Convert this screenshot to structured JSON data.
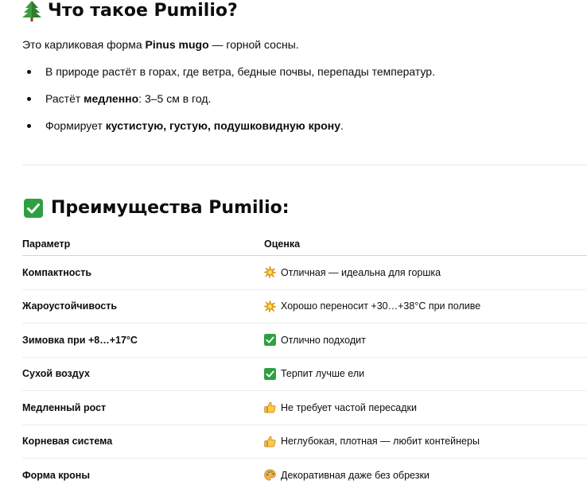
{
  "section1": {
    "title": "Что такое Pumilio?",
    "icon": "evergreen-tree-icon",
    "intro": {
      "prefix": "Это карликовая форма ",
      "bold": "Pinus mugo",
      "suffix": " — горной сосны."
    },
    "bullets": [
      {
        "prefix": "В природе растёт в горах, где ветра, бедные почвы, перепады температур.",
        "bold": "",
        "suffix": ""
      },
      {
        "prefix": "Растёт ",
        "bold": "медленно",
        "suffix": ": 3–5 см в год."
      },
      {
        "prefix": "Формирует ",
        "bold": "кустистую, густую, подушковидную крону",
        "suffix": "."
      }
    ]
  },
  "section2": {
    "title": "Преимущества Pumilio:",
    "icon": "check-mark-button-icon",
    "table": {
      "headers": [
        "Параметр",
        "Оценка"
      ],
      "rows": [
        {
          "param": "Компактность",
          "icon": "sparkle-star-icon",
          "rating": "Отличная — идеальна для горшка"
        },
        {
          "param": "Жароустойчивость",
          "icon": "sparkle-star-icon",
          "rating": "Хорошо переносит +30…+38°C при поливе"
        },
        {
          "param": "Зимовка при +8…+17°C",
          "icon": "check-mark-button-icon",
          "rating": "Отлично подходит"
        },
        {
          "param": "Сухой воздух",
          "icon": "check-mark-button-icon",
          "rating": "Терпит лучше ели"
        },
        {
          "param": "Медленный рост",
          "icon": "thumbs-up-icon",
          "rating": "Не требует частой пересадки"
        },
        {
          "param": "Корневая система",
          "icon": "thumbs-up-icon",
          "rating": "Неглубокая, плотная — любит контейнеры"
        },
        {
          "param": "Форма кроны",
          "icon": "artist-palette-icon",
          "rating": "Декоративная даже без обрезки"
        }
      ]
    }
  },
  "colors": {
    "text": "#0d0d0d",
    "check_green": "#2ea043",
    "tree_green": "#3e9b3e",
    "divider": "#e8e8e8"
  }
}
